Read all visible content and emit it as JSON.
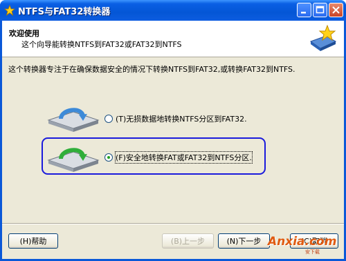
{
  "window": {
    "title": "NTFS与FAT32转换器"
  },
  "header": {
    "title": "欢迎使用",
    "subtitle": "这个向导能转换NTFS到FAT32或FAT32到NTFS"
  },
  "intro": "这个转换器专注于在确保数据安全的情况下转换NTFS到FAT32,或转换FAT32到NTFS.",
  "options": [
    {
      "label": "(T)无损数据地转换NTFS分区到FAT32.",
      "checked": false
    },
    {
      "label": "(F)安全地转换FAT或FAT32到NTFS分区.",
      "checked": true
    }
  ],
  "buttons": {
    "help": "(H)帮助",
    "back": "(B)上一步",
    "next": "(N)下一步",
    "cancel": "(C)取消"
  },
  "watermark": {
    "text": "Anxia.com",
    "sub": "安下载"
  },
  "colors": {
    "titlebar": "#0456d6",
    "highlight_box": "#1a1adc",
    "face": "#ece9d8"
  }
}
